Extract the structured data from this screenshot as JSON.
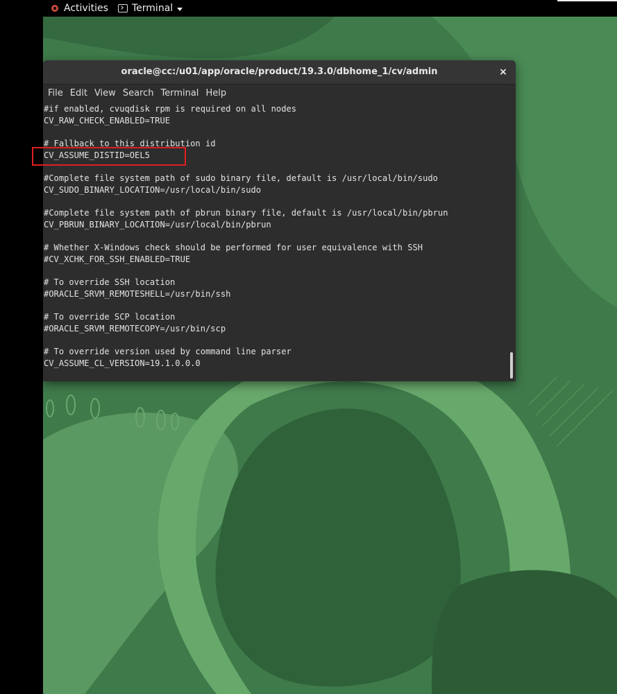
{
  "topbar": {
    "activities_label": "Activities",
    "app_menu_label": "Terminal"
  },
  "window": {
    "title": "oracle@cc:/u01/app/oracle/product/19.3.0/dbhome_1/cv/admin",
    "close_glyph": "×"
  },
  "menubar": {
    "items": [
      "File",
      "Edit",
      "View",
      "Search",
      "Terminal",
      "Help"
    ]
  },
  "terminal": {
    "lines": [
      "#if enabled, cvuqdisk rpm is required on all nodes",
      "CV_RAW_CHECK_ENABLED=TRUE",
      "",
      "# Fallback to this distribution id",
      "CV_ASSUME_DISTID=OEL5",
      "",
      "#Complete file system path of sudo binary file, default is /usr/local/bin/sudo",
      "CV_SUDO_BINARY_LOCATION=/usr/local/bin/sudo",
      "",
      "#Complete file system path of pbrun binary file, default is /usr/local/bin/pbrun",
      "CV_PBRUN_BINARY_LOCATION=/usr/local/bin/pbrun",
      "",
      "# Whether X-Windows check should be performed for user equivalence with SSH",
      "#CV_XCHK_FOR_SSH_ENABLED=TRUE",
      "",
      "# To override SSH location",
      "#ORACLE_SRVM_REMOTESHELL=/usr/bin/ssh",
      "",
      "# To override SCP location",
      "#ORACLE_SRVM_REMOTECOPY=/usr/bin/scp",
      "",
      "# To override version used by command line parser",
      "CV_ASSUME_CL_VERSION=19.1.0.0.0"
    ]
  },
  "colors": {
    "desktop_green": "#3f7a4b",
    "terminal_bg": "#2d2d2d",
    "highlight_red": "#e02020"
  },
  "icons": {
    "activities": "os-logo-icon",
    "app_menu": "terminal-app-icon",
    "dropdown": "caret-down-icon",
    "close": "close-icon"
  }
}
